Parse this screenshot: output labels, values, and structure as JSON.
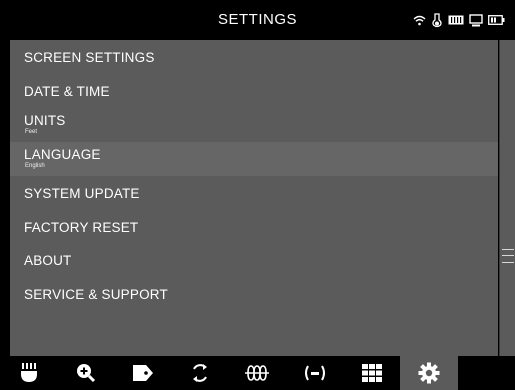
{
  "header": {
    "title": "SETTINGS"
  },
  "menu": [
    {
      "label": "SCREEN SETTINGS",
      "sub": ""
    },
    {
      "label": "DATE & TIME",
      "sub": ""
    },
    {
      "label": "UNITS",
      "sub": "Feet"
    },
    {
      "label": "LANGUAGE",
      "sub": "English"
    },
    {
      "label": "SYSTEM UPDATE",
      "sub": ""
    },
    {
      "label": "FACTORY RESET",
      "sub": ""
    },
    {
      "label": "ABOUT",
      "sub": ""
    },
    {
      "label": "SERVICE & SUPPORT",
      "sub": ""
    }
  ],
  "status_icons": [
    "wifi-icon",
    "temperature-icon",
    "storage-icon",
    "monitor-icon",
    "battery-icon"
  ],
  "toolbar": [
    "probe-icon",
    "zoom-in-icon",
    "tag-icon",
    "rotate-icon",
    "waveform-icon",
    "signal-icon",
    "grid-icon",
    "gear-icon"
  ],
  "colors": {
    "panel": "#5b5b5b",
    "highlight": "#666666",
    "background": "#000000",
    "text": "#ffffff"
  }
}
